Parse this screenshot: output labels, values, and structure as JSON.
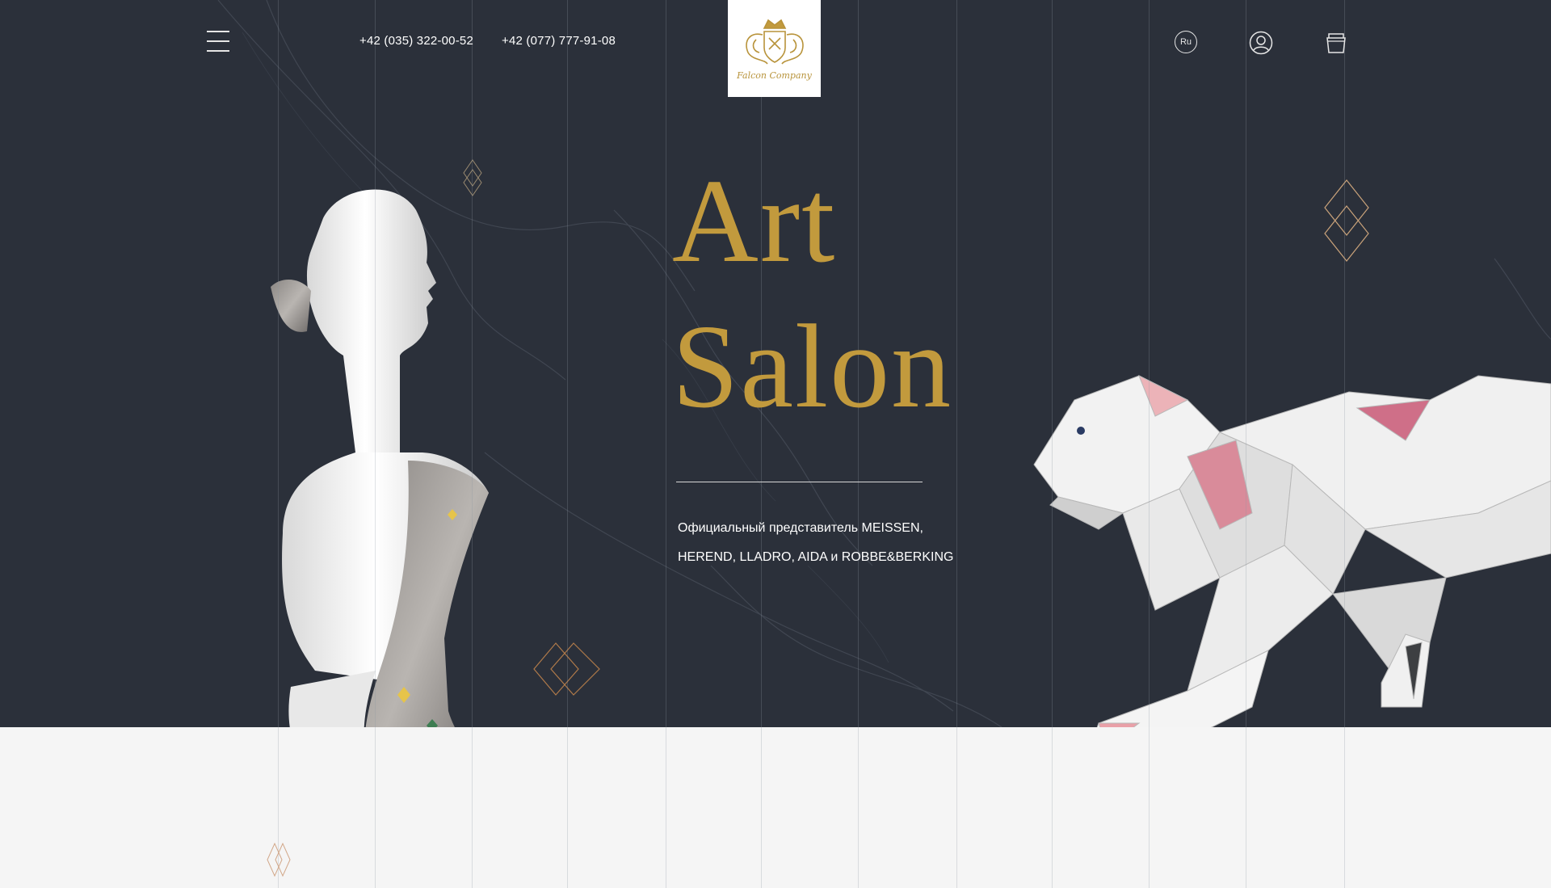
{
  "header": {
    "menu_icon": "hamburger-menu-icon",
    "phones": [
      "+42 (035) 322-00-52",
      "+42 (077) 777-91-08"
    ],
    "logo": {
      "text": "Falcon Company",
      "icon": "crest-logo-icon"
    },
    "language_label": "Ru",
    "user_icon": "user-account-icon",
    "cart_icon": "shopping-bag-icon"
  },
  "hero": {
    "title_line1": "Art",
    "title_line2": "Salon",
    "subtitle_line1": "Официальный представитель MEISSEN,",
    "subtitle_line2": "HEREND, LLADRO, AIDA и ROBBE&BERKING",
    "images": [
      "porcelain-woman-bust",
      "geometric-porcelain-panther"
    ]
  },
  "colors": {
    "background_dark": "#2b303a",
    "background_light": "#f5f5f5",
    "accent_gold": "#c29a3d",
    "text_light": "#ffffff"
  }
}
